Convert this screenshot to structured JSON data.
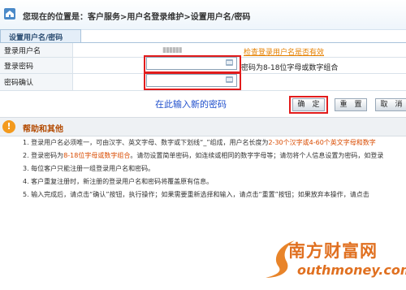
{
  "breadcrumb": {
    "icon": "home-icon",
    "text": "您现在的位置是：客户服务>用户名登录维护>设置用户名/密码"
  },
  "tab": {
    "label": "设置用户名/密码"
  },
  "form": {
    "username_label": "登录用户名",
    "username_masked": "▮▮▮▮▮▮",
    "check_link": "检查登录用户名是否有效",
    "password_label": "登录密码",
    "password_value": "",
    "password_hint": "密码为8-18位字母或数字组合",
    "confirm_label": "密码确认",
    "confirm_value": "",
    "keyboard_icon": "soft-keyboard-icon"
  },
  "annotation": "在此输入新的密码",
  "buttons": {
    "ok": "确　定",
    "reset": "重　置",
    "cancel": "取　消"
  },
  "help": {
    "title": "帮助和其他",
    "icon": "info-icon",
    "items": [
      {
        "a": "1. 登录用户名必须唯一，可由汉字、英文字母、数字或下划线“_”组成，用户名长度为",
        "b": "2-30个汉字或4-60个英文字母和数字",
        "c": ""
      },
      {
        "a": "2. 登录密码为",
        "b": "8-18位字母或数字组合",
        "c": "。请勿设置简单密码，如连续或相同的数字字母等；请勿将个人信息设置为密码，如登录"
      },
      {
        "a": "3. 每位客户只能注册一组登录用户名和密码。",
        "b": "",
        "c": ""
      },
      {
        "a": "4. 客户重复注册时，新注册的登录用户名和密码将覆盖原有信息。",
        "b": "",
        "c": ""
      },
      {
        "a": "5. 输入完成后，请点击“确认”按钮，执行操作；如果需要重新选择和输入，请点击“重置”按钮；如果放弃本操作，请点击",
        "b": "",
        "c": ""
      }
    ]
  },
  "watermark": {
    "cn": "南方财富网",
    "en": "outhmoney.com"
  },
  "colors": {
    "accent": "#e58000",
    "highlight": "#e21c1c",
    "note": "#1f4fcc"
  }
}
